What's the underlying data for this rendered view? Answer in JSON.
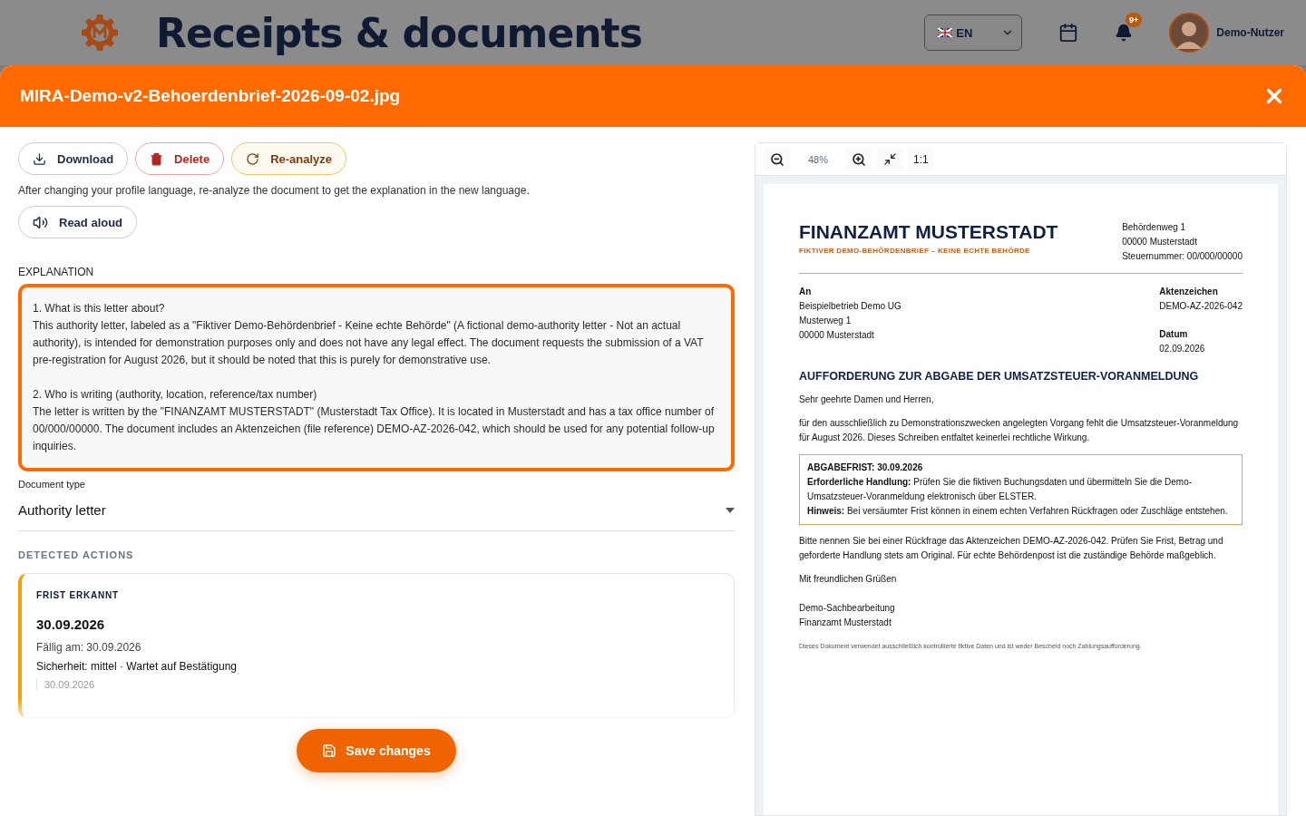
{
  "header": {
    "title": "Receipts & documents",
    "language": "EN",
    "notification_count": "9+",
    "user_name": "Demo-Nutzer"
  },
  "modal": {
    "title": "MIRA-Demo-v2-Behoerdenbrief-2026-09-02.jpg"
  },
  "actions": [
    {
      "label": "Download",
      "kind": "download"
    },
    {
      "label": "Delete",
      "kind": "delete"
    },
    {
      "label": "Re-analyze",
      "kind": "reanalyze"
    }
  ],
  "hint": "After changing your profile language, re-analyze the document to get the explanation in the new language.",
  "read_aloud": "Read aloud",
  "explanation": {
    "label": "EXPLANATION",
    "paragraphs": [
      {
        "heading": "1. What is this letter about?",
        "text": "This authority letter, labeled as a \"Fiktiver Demo-Behördenbrief - Keine echte Behörde\" (A fictional demo-authority letter - Not an actual authority), is intended for demonstration purposes only and does not have any legal effect. The document requests the submission of a VAT pre-registration for August 2026, but it should be noted that this is purely for demonstrative use."
      },
      {
        "heading": "2. Who is writing (authority, location, reference/tax number)",
        "text": "The letter is written by the \"FINANZAMT MUSTERSTADT\" (Musterstadt Tax Office). It is located in Musterstadt and has a tax office number of 00/000/00000. The document includes an Aktenzeichen (file reference) DEMO-AZ-2026-042, which should be used for any potential follow-up inquiries."
      }
    ]
  },
  "document_type": {
    "label": "Document type",
    "value": "Authority letter"
  },
  "detected_actions": {
    "heading": "DETECTED ACTIONS",
    "items": [
      {
        "type": "FRIST ERKANNT",
        "date": "30.09.2026",
        "due": "Fällig am: 30.09.2026",
        "status": "Sicherheit: mittel · Wartet auf Bestätigung",
        "field_value": "30.09.2026"
      }
    ]
  },
  "save_button": "Save changes",
  "viewer": {
    "zoom": "48%",
    "actual_size": "1:1",
    "document": {
      "title": "FINANZAMT MUSTERSTADT",
      "subtitle": "FIKTIVER DEMO-BEHÖRDENBRIEF – KEINE ECHTE BEHÖRDE",
      "sender": [
        "Behördenweg 1",
        "00000 Musterstadt",
        "Steuernummer: 00/000/00000"
      ],
      "recipient_label": "An",
      "recipient": [
        "Beispielbetrieb Demo UG",
        "Musterweg 1",
        "00000 Musterstadt"
      ],
      "reference_label": "Aktenzeichen",
      "reference": "DEMO-AZ-2026-042",
      "date_label": "Datum",
      "date": "02.09.2026",
      "subject": "AUFFORDERUNG ZUR ABGABE DER UMSATZSTEUER-VORANMELDUNG",
      "salutation": "Sehr geehrte Damen und Herren,",
      "body": "für den ausschließlich zu Demonstrationszwecken angelegten Vorgang fehlt die Umsatzsteuer-Voranmeldung für August 2026. Dieses Schreiben entfaltet keinerlei rechtliche Wirkung.",
      "notice": [
        "**ABGABEFRIST: 30.09.2026**",
        "**Erforderliche Handlung:** Prüfen Sie die fiktiven Buchungsdaten und übermitteln Sie die Demo-Umsatzsteuer-Voranmeldung elektronisch über ELSTER.",
        "**Hinweis:** Bei versäumter Frist können in einem echten Verfahren Rückfragen oder Zuschläge entstehen."
      ],
      "closing": "Bitte nennen Sie bei einer Rückfrage das Aktenzeichen DEMO-AZ-2026-042. Prüfen Sie Frist, Betrag und geforderte Handlung stets am Original. Für echte Behördenpost ist die zuständige Behörde maßgeblich.",
      "greeting": "Mit freundlichen Grüßen",
      "signature": [
        "Demo-Sachbearbeitung",
        "Finanzamt Musterstadt"
      ],
      "footer": "Dieses Dokument verwendet ausschließlich kontrollierte fiktive Daten und ist weder Bescheid noch Zahlungsaufforderung."
    }
  }
}
